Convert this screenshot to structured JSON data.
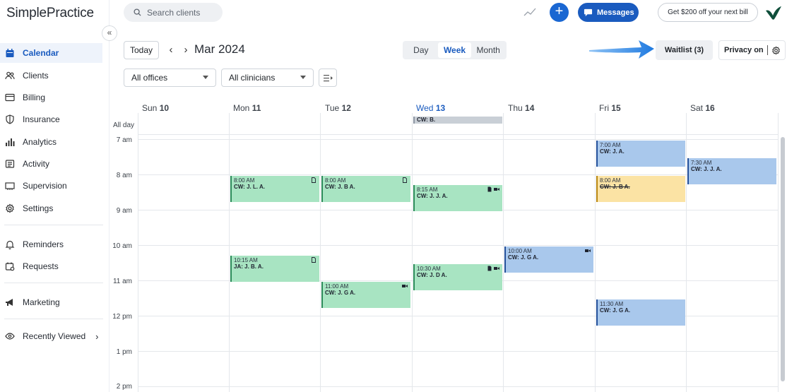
{
  "app": {
    "logo": "SimplePractice"
  },
  "sidebar": {
    "items": [
      {
        "label": "Calendar",
        "icon": "calendar-icon",
        "active": true
      },
      {
        "label": "Clients",
        "icon": "clients-icon"
      },
      {
        "label": "Billing",
        "icon": "billing-icon"
      },
      {
        "label": "Insurance",
        "icon": "insurance-icon"
      },
      {
        "label": "Analytics",
        "icon": "analytics-icon"
      },
      {
        "label": "Activity",
        "icon": "activity-icon"
      },
      {
        "label": "Supervision",
        "icon": "supervision-icon"
      },
      {
        "label": "Settings",
        "icon": "gear-icon"
      },
      {
        "label": "Reminders",
        "icon": "bell-icon"
      },
      {
        "label": "Requests",
        "icon": "requests-icon"
      },
      {
        "label": "Marketing",
        "icon": "megaphone-icon"
      },
      {
        "label": "Recently Viewed",
        "icon": "eye-icon"
      }
    ]
  },
  "topbar": {
    "search_placeholder": "Search clients",
    "messages_label": "Messages",
    "promo_label": "Get $200 off your next bill",
    "plus_label": "+"
  },
  "toolbar": {
    "today_label": "Today",
    "month_label": "Mar 2024",
    "views": [
      "Day",
      "Week",
      "Month"
    ],
    "active_view": "Week",
    "waitlist_label": "Waitlist (3)",
    "privacy_label": "Privacy on",
    "offices_select": "All offices",
    "clinicians_select": "All clinicians"
  },
  "calendar": {
    "days": [
      {
        "name": "Sun",
        "num": "10"
      },
      {
        "name": "Mon",
        "num": "11"
      },
      {
        "name": "Tue",
        "num": "12"
      },
      {
        "name": "Wed",
        "num": "13",
        "today": true
      },
      {
        "name": "Thu",
        "num": "14"
      },
      {
        "name": "Fri",
        "num": "15"
      },
      {
        "name": "Sat",
        "num": "16"
      }
    ],
    "allday_label": "All day",
    "allday_event": "CW: B.",
    "hours": [
      "7 am",
      "8 am",
      "9 am",
      "10 am",
      "11 am",
      "12 pm",
      "1 pm",
      "2 pm"
    ],
    "events": [
      {
        "time": "8:00 AM",
        "name": "CW: J. L. A.",
        "color": "green",
        "icons": [
          "doc"
        ]
      },
      {
        "time": "8:00 AM",
        "name": "CW: J. B A.",
        "color": "green",
        "icons": [
          "doc"
        ]
      },
      {
        "time": "8:15 AM",
        "name": "CW: J. J. A.",
        "color": "green",
        "icons": [
          "doc",
          "video"
        ]
      },
      {
        "time": "7:00 AM",
        "name": "CW: J. A.",
        "color": "blue",
        "icons": []
      },
      {
        "time": "8:00 AM",
        "name": "CW: J. B A.",
        "color": "yellow",
        "icons": []
      },
      {
        "time": "7:30 AM",
        "name": "CW: J. J. A.",
        "color": "blue",
        "icons": []
      },
      {
        "time": "10:15 AM",
        "name": "JA: J. B. A.",
        "color": "green",
        "icons": [
          "doc"
        ]
      },
      {
        "time": "10:00 AM",
        "name": "CW: J. G A.",
        "color": "blue",
        "icons": [
          "video"
        ]
      },
      {
        "time": "10:30 AM",
        "name": "CW: J. D A.",
        "color": "green",
        "icons": [
          "doc",
          "video"
        ]
      },
      {
        "time": "11:00 AM",
        "name": "CW: J. G A.",
        "color": "green",
        "icons": [
          "video"
        ]
      },
      {
        "time": "11:30 AM",
        "name": "CW: J. G A.",
        "color": "blue",
        "icons": []
      }
    ]
  },
  "colors": {
    "accent": "#1a5bbf",
    "event_green": "#a8e4c2",
    "event_blue": "#a9c8ec",
    "event_yellow": "#fbe3a4"
  }
}
